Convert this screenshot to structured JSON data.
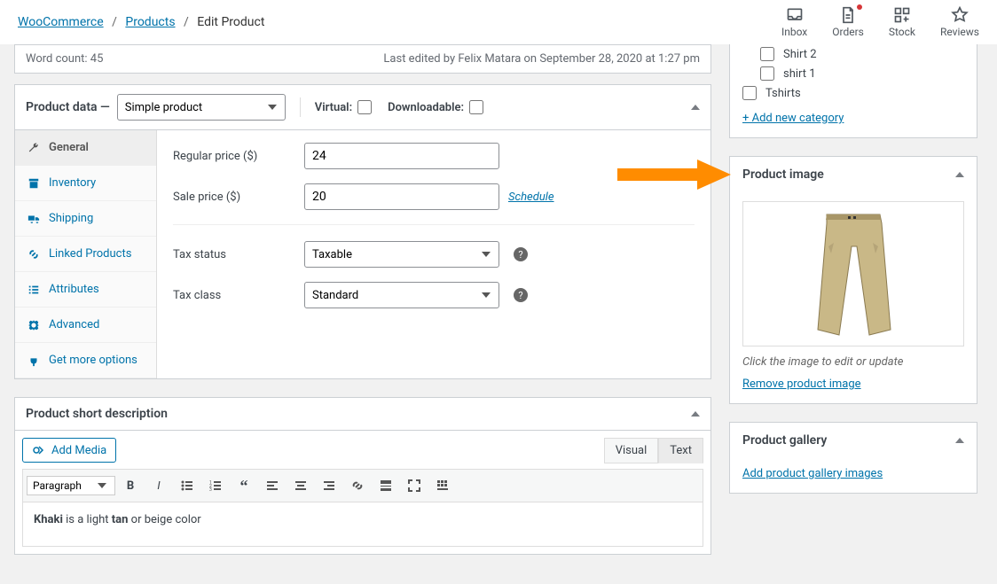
{
  "breadcrumb": {
    "woo": "WooCommerce",
    "products": "Products",
    "current": "Edit Product"
  },
  "toolbar": {
    "inbox": "Inbox",
    "orders": "Orders",
    "stock": "Stock",
    "reviews": "Reviews"
  },
  "wordcount": {
    "label": "Word count: 45",
    "lastedit": "Last edited by Felix Matara on September 28, 2020 at 1:27 pm"
  },
  "productData": {
    "title": "Product data —",
    "type_selected": "Simple product",
    "virtual_label": "Virtual:",
    "downloadable_label": "Downloadable:",
    "tabs": {
      "general": "General",
      "inventory": "Inventory",
      "shipping": "Shipping",
      "linked": "Linked Products",
      "attributes": "Attributes",
      "advanced": "Advanced",
      "getmore": "Get more options"
    },
    "fields": {
      "regular_label": "Regular price ($)",
      "regular_value": "24",
      "sale_label": "Sale price ($)",
      "sale_value": "20",
      "schedule": "Schedule",
      "tax_status_label": "Tax status",
      "tax_status_value": "Taxable",
      "tax_class_label": "Tax class",
      "tax_class_value": "Standard"
    }
  },
  "shortDesc": {
    "title": "Product short description",
    "add_media": "Add Media",
    "visual": "Visual",
    "text": "Text",
    "para": "Paragraph",
    "content_html": "<b>Khaki</b> is a light <b>tan</b> or beige color"
  },
  "categories": {
    "shirt2": "Shirt 2",
    "shirt1": "shirt 1",
    "tshirts": "Tshirts",
    "add_new": "+ Add new category"
  },
  "productImage": {
    "title": "Product image",
    "hint": "Click the image to edit or update",
    "remove": "Remove product image"
  },
  "gallery": {
    "title": "Product gallery",
    "add": "Add product gallery images"
  }
}
